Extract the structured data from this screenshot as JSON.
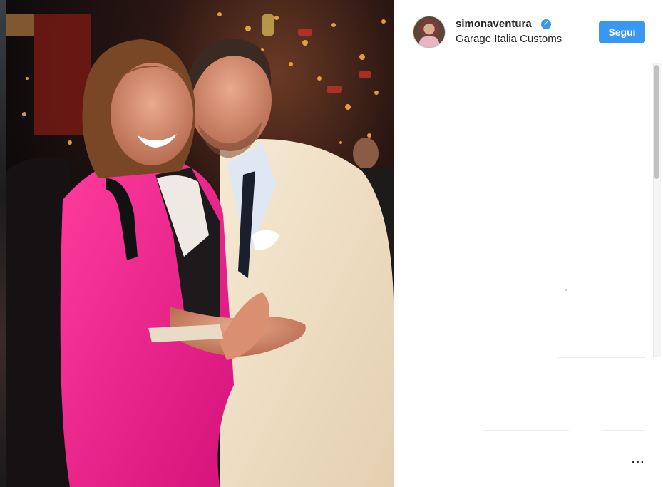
{
  "post": {
    "username": "simonaventura",
    "verified": true,
    "location": "Garage Italia Customs",
    "follow_label": "Segui",
    "more_label": "···"
  },
  "colors": {
    "accent": "#3897f0",
    "text": "#262626",
    "divider": "#efefef"
  },
  "icons": {
    "verified": "verified-badge-icon",
    "more": "more-options-icon"
  }
}
